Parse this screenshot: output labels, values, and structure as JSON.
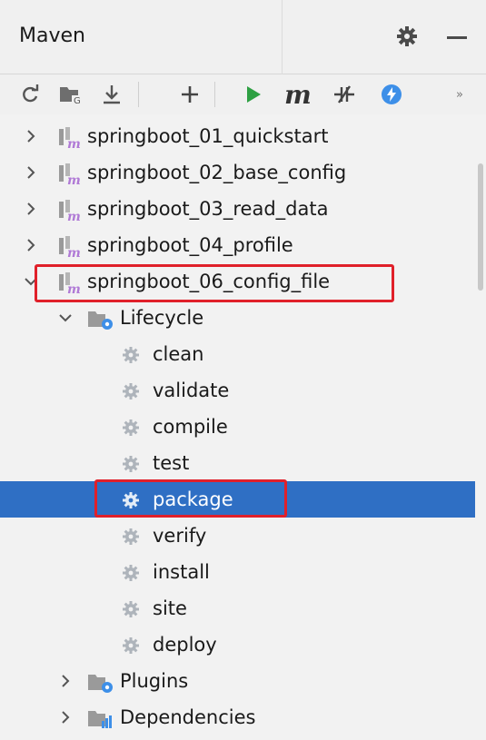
{
  "header": {
    "title": "Maven"
  },
  "toolbar": {
    "items": [
      "reload-icon",
      "generate-sources-icon",
      "download-icon",
      "add-icon",
      "run-icon",
      "execute-goal-icon",
      "skip-tests-icon",
      "offline-icon",
      "more-icon"
    ],
    "execute_goal_label": "m",
    "more_label": "»"
  },
  "tree": {
    "projects": [
      {
        "label": "springboot_01_quickstart",
        "expanded": false
      },
      {
        "label": "springboot_02_base_config",
        "expanded": false
      },
      {
        "label": "springboot_03_read_data",
        "expanded": false
      },
      {
        "label": "springboot_04_profile",
        "expanded": false
      },
      {
        "label": "springboot_06_config_file",
        "expanded": true
      }
    ],
    "lifecycle": {
      "label": "Lifecycle",
      "goals": [
        "clean",
        "validate",
        "compile",
        "test",
        "package",
        "verify",
        "install",
        "site",
        "deploy"
      ],
      "selected": "package"
    },
    "plugins": {
      "label": "Plugins"
    },
    "dependencies": {
      "label": "Dependencies"
    }
  },
  "colors": {
    "selection": "#2f6fc4",
    "highlight_box": "#e0202a",
    "run_green": "#2ea043",
    "offline_blue": "#3d8fe8",
    "maven_m": "#b07ad6"
  }
}
